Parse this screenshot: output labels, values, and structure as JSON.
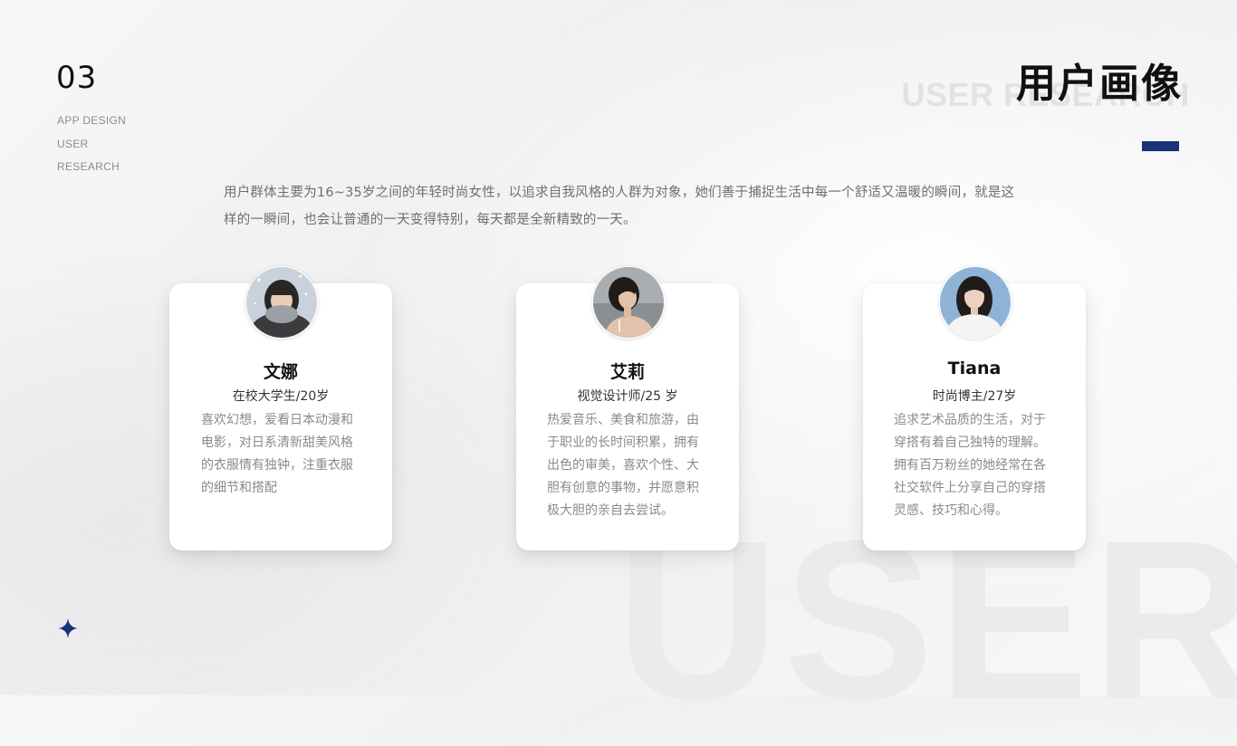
{
  "section_number": "03",
  "side_labels": [
    "APP DESIGN",
    "USER",
    "RESEARCH"
  ],
  "title": "用户画像",
  "title_en": "USER RESEARCH",
  "background_word": "USER",
  "intro_lines": [
    "用户群体主要为16~35岁之间的年轻时尚女性，以追求自我风格的人群为对象，她们善于捕捉生活中每一个舒适又温暖的瞬间，就是这",
    "样的一瞬间，也会让普通的一天变得特别，每天都是全新精致的一天。"
  ],
  "personas": [
    {
      "name": "文娜",
      "role": "在校大学生/20岁",
      "desc_lines": [
        "喜欢幻想，爱看日本动漫和",
        "电影，对日系清新甜美风格",
        "的衣服情有独钟，注重衣服",
        "的细节和搭配"
      ]
    },
    {
      "name": "艾莉",
      "role": "视觉设计师/25 岁",
      "desc_lines": [
        "热爱音乐、美食和旅游，由",
        "于职业的长时间积累，拥有",
        "出色的审美，喜欢个性、大",
        "胆有创意的事物，并愿意积",
        "极大胆的亲自去尝试。"
      ]
    },
    {
      "name": "Tiana",
      "role": "时尚博主/27岁",
      "desc_lines": [
        "追求艺术品质的生活，对于",
        "穿搭有着自己独特的理解。",
        "拥有百万粉丝的她经常在各",
        "社交软件上分享自己的穿搭",
        "灵感、技巧和心得。"
      ]
    }
  ],
  "colors": {
    "accent": "#17337a",
    "text_dark": "#111111",
    "text_muted": "#8a8a8a"
  },
  "icons": {
    "decor": "four-point-star-icon"
  }
}
